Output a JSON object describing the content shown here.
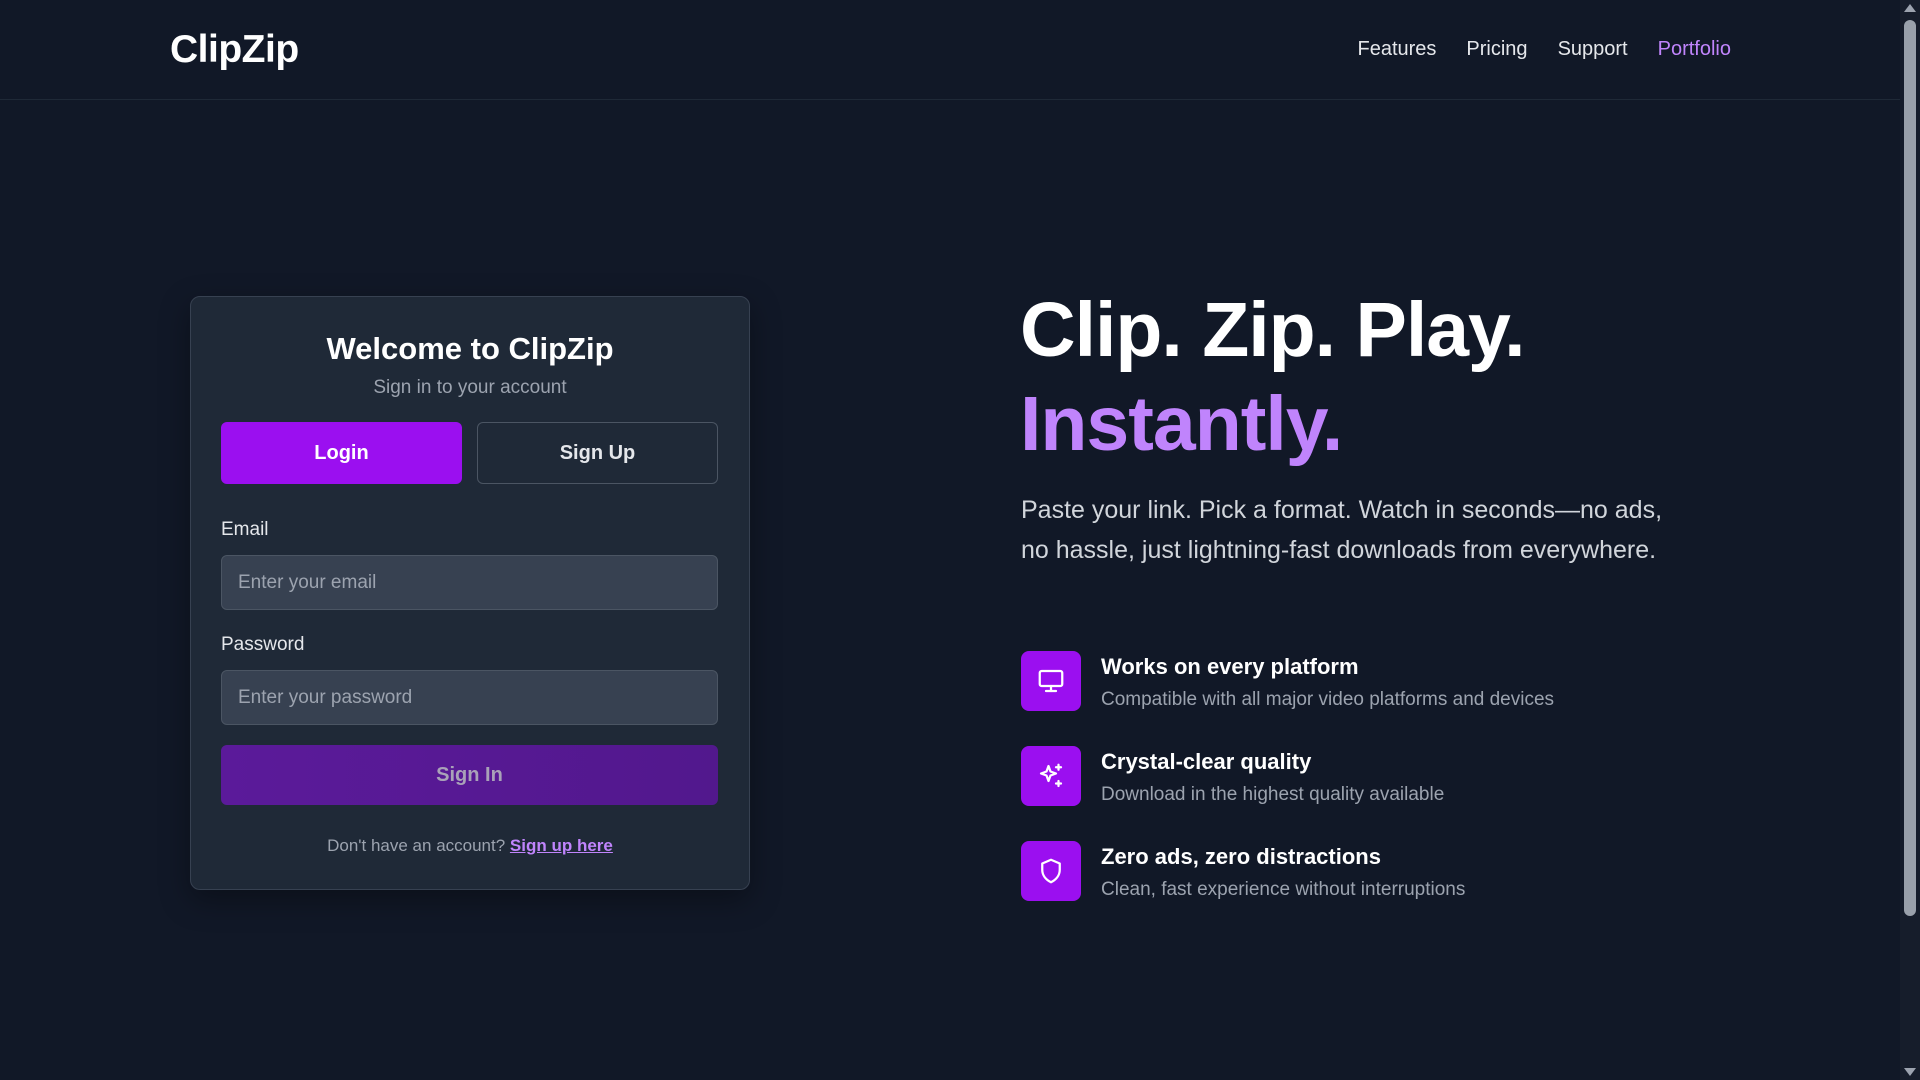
{
  "header": {
    "logo": "ClipZip",
    "nav": [
      {
        "label": "Features"
      },
      {
        "label": "Pricing"
      },
      {
        "label": "Support"
      },
      {
        "label": "Portfolio",
        "active": true
      }
    ]
  },
  "auth_card": {
    "title": "Welcome to ClipZip",
    "subtitle": "Sign in to your account",
    "tabs": {
      "login": "Login",
      "signup": "Sign Up"
    },
    "email": {
      "label": "Email",
      "placeholder": "Enter your email",
      "value": ""
    },
    "password": {
      "label": "Password",
      "placeholder": "Enter your password",
      "value": ""
    },
    "submit_label": "Sign In",
    "footer_text": "Don't have an account?",
    "footer_link": "Sign up here"
  },
  "hero": {
    "headline_line1": "Clip. Zip. Play.",
    "headline_line2": "Instantly.",
    "description": "Paste your link. Pick a format. Watch in seconds—no ads, no hassle, just lightning-fast downloads from everywhere."
  },
  "features": [
    {
      "icon": "monitor-icon",
      "title": "Works on every platform",
      "description": "Compatible with all major video platforms and devices"
    },
    {
      "icon": "sparkles-icon",
      "title": "Crystal-clear quality",
      "description": "Download in the highest quality available"
    },
    {
      "icon": "shield-icon",
      "title": "Zero ads, zero distractions",
      "description": "Clean, fast experience without interruptions"
    }
  ],
  "colors": {
    "background": "#111827",
    "card": "#1f2937",
    "accent": "#9b0ff0",
    "accent_text": "#c084fc"
  }
}
